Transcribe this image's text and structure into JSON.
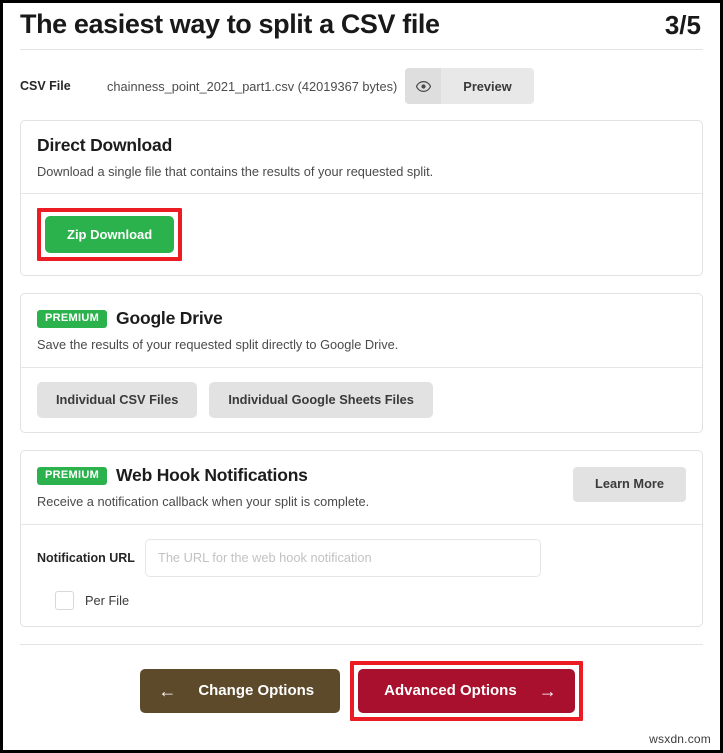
{
  "header": {
    "title": "The easiest way to split a CSV file",
    "step": "3/5"
  },
  "file_row": {
    "label": "CSV File",
    "filename": "chainness_point_2021_part1.csv (42019367 bytes)",
    "eye_icon": "eye-icon",
    "preview_label": "Preview"
  },
  "direct_download": {
    "title": "Direct Download",
    "description": "Download a single file that contains the results of your requested split.",
    "zip_button": "Zip Download"
  },
  "google_drive": {
    "badge": "PREMIUM",
    "title": "Google Drive",
    "description": "Save the results of your requested split directly to Google Drive.",
    "buttons": [
      "Individual CSV Files",
      "Individual Google Sheets Files"
    ]
  },
  "web_hook": {
    "badge": "PREMIUM",
    "title": "Web Hook Notifications",
    "description": "Receive a notification callback when your split is complete.",
    "learn_more": "Learn More",
    "url_label": "Notification URL",
    "url_value": "",
    "url_placeholder": "The URL for the web hook notification",
    "per_file_label": "Per File"
  },
  "footer": {
    "back_label": "Change Options",
    "back_arrow": "←",
    "next_label": "Advanced Options",
    "next_arrow": "→"
  },
  "watermark": "wsxdn.com",
  "colors": {
    "green": "#2bb24c",
    "crimson": "#a8102e",
    "brown": "#5d4a2b",
    "annotation_red": "#ec1c24",
    "gray_button": "#e2e2e2"
  }
}
